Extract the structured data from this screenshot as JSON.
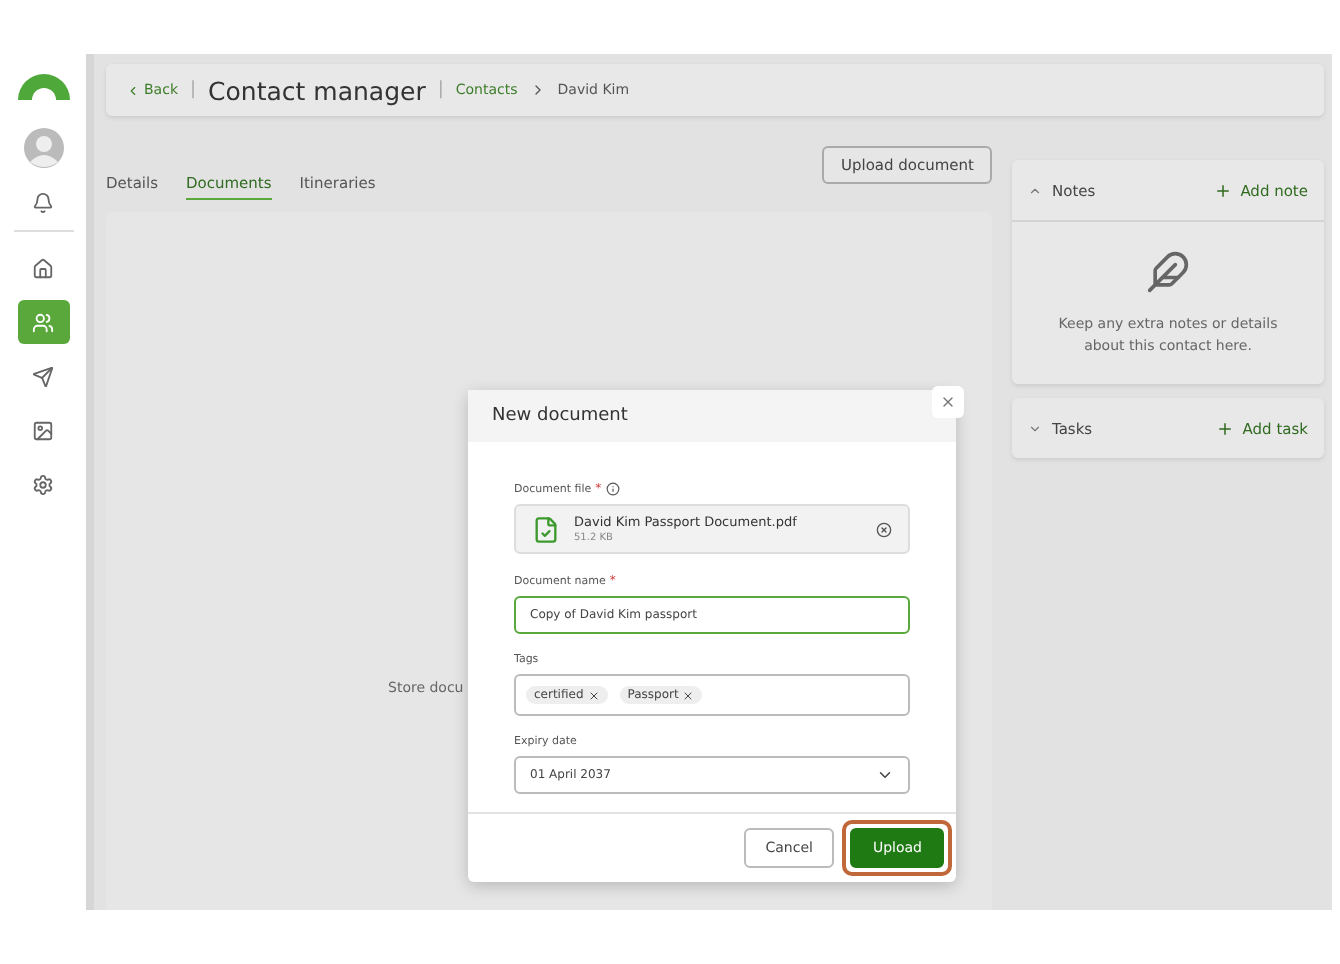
{
  "sidebar": {
    "items": [
      {
        "kind": "home",
        "selected": false
      },
      {
        "kind": "contacts",
        "selected": true
      },
      {
        "kind": "send",
        "selected": false
      },
      {
        "kind": "image",
        "selected": false
      },
      {
        "kind": "settings",
        "selected": false
      }
    ]
  },
  "header": {
    "back": "Back",
    "separator": "|",
    "title": "Contact manager",
    "breadcrumbs": [
      "Contacts",
      "David Kim"
    ]
  },
  "tabs": [
    {
      "label": "Details",
      "selected": false
    },
    {
      "label": "Documents",
      "selected": true
    },
    {
      "label": "Itineraries",
      "selected": false
    }
  ],
  "upload_button": "Upload document",
  "empty_text": "Store docu",
  "notes": {
    "title": "Notes",
    "expanded": true,
    "action": "Add note",
    "empty_text": "Keep any extra notes or details about this contact here."
  },
  "tasks": {
    "title": "Tasks",
    "expanded": false,
    "action": "Add task"
  },
  "dialog": {
    "title": "New document",
    "file": {
      "label": "Document file",
      "required": "*",
      "name": "David Kim Passport Document.pdf",
      "size": "51.2 KB"
    },
    "name_field": {
      "label": "Document name",
      "required": "*",
      "value": "Copy of David Kim passport"
    },
    "tags": {
      "label": "Tags",
      "items": [
        "certified",
        "Passport"
      ]
    },
    "expiry": {
      "label": "Expiry date",
      "value": "01 April 2037"
    },
    "buttons": [
      {
        "label": "Cancel",
        "kind": "secondary",
        "highlighted": false
      },
      {
        "label": "Upload",
        "kind": "primary",
        "highlighted": true
      }
    ]
  }
}
